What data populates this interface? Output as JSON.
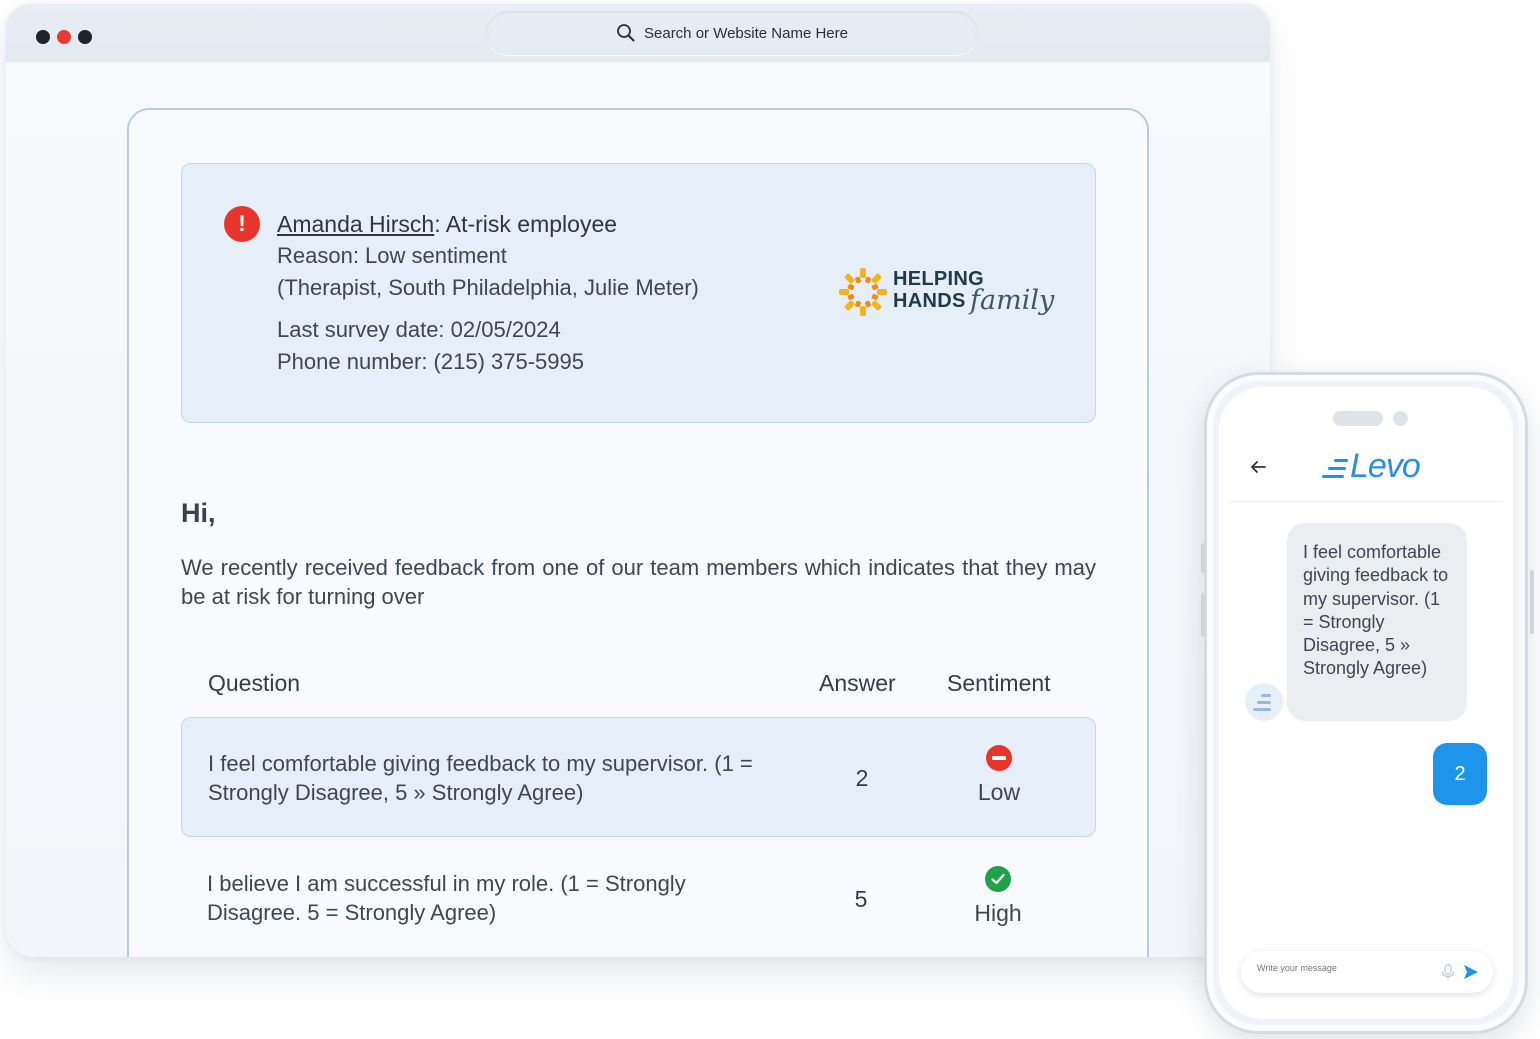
{
  "browser": {
    "address_placeholder": "Search or Website Name Here"
  },
  "alert": {
    "employee_name": "Amanda Hirsch",
    "title_suffix": ": At-risk employee",
    "reason": "Reason: Low sentiment",
    "details": "(Therapist, South Philadelphia, Julie Meter)",
    "last_survey": "Last survey date: 02/05/2024",
    "phone": "Phone number: (215) 375-5995",
    "logo_line1": "HELPING",
    "logo_line2": "HANDS",
    "logo_script": "family"
  },
  "email": {
    "greeting": "Hi,",
    "intro": "We recently received feedback from one of our team members which indicates that they may be at risk for turning over"
  },
  "table": {
    "headers": {
      "question": "Question",
      "answer": "Answer",
      "sentiment": "Sentiment"
    },
    "rows": [
      {
        "question": "I feel comfortable giving feedback to my supervisor. (1 = Strongly Disagree, 5 » Strongly Agree)",
        "answer": "2",
        "sentiment": "Low"
      },
      {
        "question": "I believe I am successful in my role. (1 = Strongly Disagree. 5 = Strongly Agree)",
        "answer": "5",
        "sentiment": "High"
      }
    ]
  },
  "phone": {
    "app_name": "Levo",
    "incoming_message": "I feel comfortable giving feedback to my supervisor. (1 = Strongly Disagree, 5 » Strongly Agree)",
    "outgoing_message": "2",
    "input_placeholder": "Write your message"
  },
  "colors": {
    "alert_red": "#e8352c",
    "positive_green": "#1fa049",
    "levo_blue": "#2b8ee0",
    "bubble_blue": "#1d95ea",
    "panel_blue": "#e6eef8"
  },
  "icons": {
    "address": "search-icon",
    "alert": "exclamation-icon",
    "low": "minus-circle-icon",
    "high": "check-circle-icon",
    "back": "arrow-left-icon",
    "mic": "microphone-icon",
    "send": "send-icon"
  }
}
